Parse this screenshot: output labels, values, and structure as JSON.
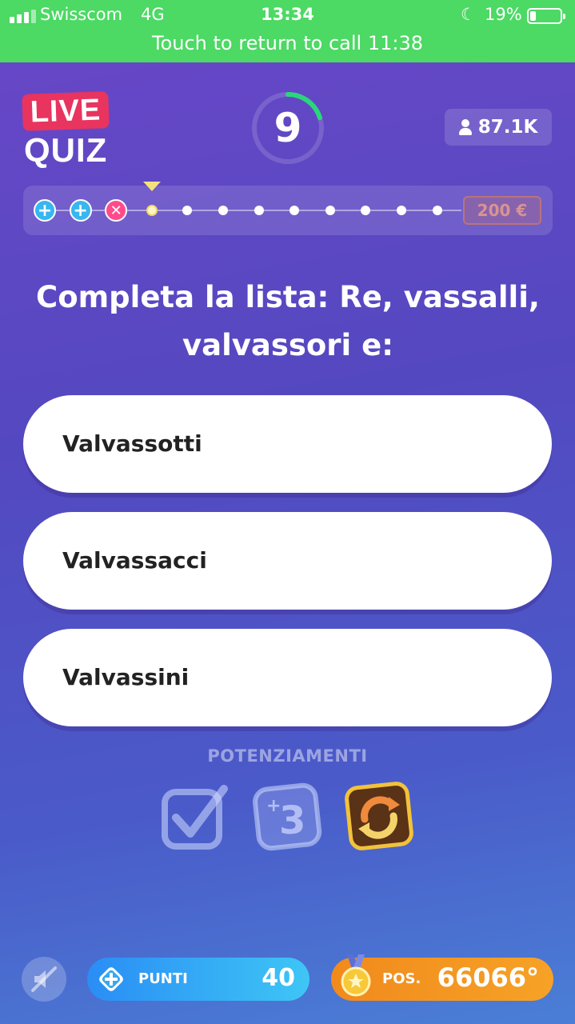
{
  "status_bar": {
    "carrier": "Swisscom",
    "network": "4G",
    "time": "13:34",
    "battery_percent": "19%",
    "battery_level": 0.19,
    "call_banner": "Touch to return to call 11:38",
    "background_color": "#4cd964"
  },
  "header": {
    "logo_live": "LIVE",
    "logo_quiz": "QUIZ",
    "timer_value": "9",
    "timer_fraction_remaining": 0.2,
    "viewers_count": "87.1K"
  },
  "progress": {
    "steps": [
      "plus",
      "plus",
      "cross",
      "current",
      "dot",
      "dot",
      "dot",
      "dot",
      "dot",
      "dot",
      "dot",
      "dot"
    ],
    "prize_label": "200 €"
  },
  "question": {
    "text": "Completa la lista: Re, vassalli, valvassori e:"
  },
  "answers": [
    {
      "label": "Valvassotti"
    },
    {
      "label": "Valvassacci"
    },
    {
      "label": "Valvassini"
    }
  ],
  "powerups": {
    "title": "POTENZIAMENTI",
    "items": [
      {
        "name": "checkmark-icon",
        "enabled": false
      },
      {
        "name": "plus-three-icon",
        "enabled": false
      },
      {
        "name": "refresh-icon",
        "enabled": true
      }
    ]
  },
  "bottom_bar": {
    "points_label": "PUNTI",
    "points_value": "40",
    "position_label": "POS.",
    "position_value": "66066°",
    "points_color": "#2a8df5",
    "position_color": "#f18a1c"
  }
}
